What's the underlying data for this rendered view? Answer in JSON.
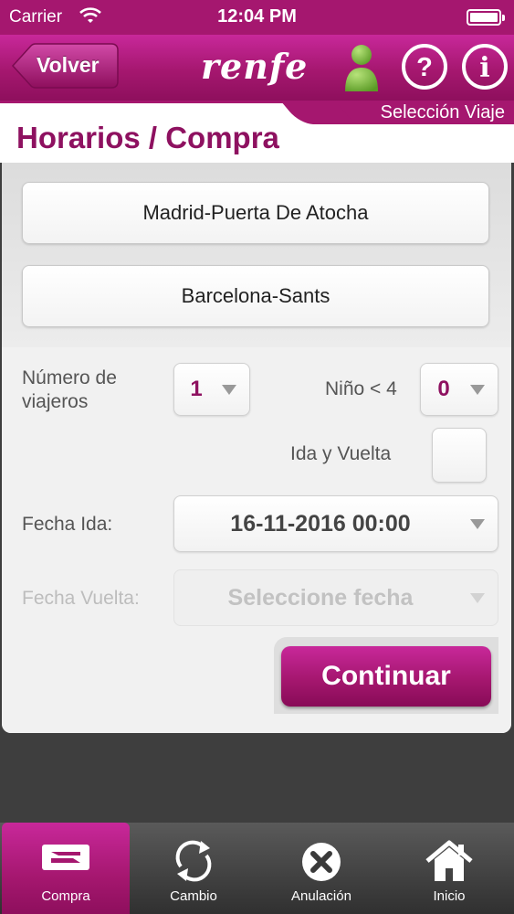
{
  "status_bar": {
    "carrier": "Carrier",
    "time": "12:04 PM"
  },
  "nav": {
    "back_label": "Volver",
    "brand": "renfe"
  },
  "step_label": "Selección Viaje",
  "page_title": "Horarios / Compra",
  "origin_station": "Madrid-Puerta De Atocha",
  "destination_station": "Barcelona-Sants",
  "travelers": {
    "label": "Número de viajeros",
    "value": "1"
  },
  "children": {
    "label": "Niño < 4",
    "value": "0"
  },
  "round_trip": {
    "label": "Ida y Vuelta",
    "checked": false
  },
  "departure_date": {
    "label": "Fecha Ida:",
    "value": "16-11-2016 00:00"
  },
  "return_date": {
    "label": "Fecha Vuelta:",
    "placeholder": "Seleccione fecha"
  },
  "continue_label": "Continuar",
  "tabs": [
    {
      "label": "Compra",
      "icon": "ticket-icon",
      "active": true
    },
    {
      "label": "Cambio",
      "icon": "exchange-icon",
      "active": false
    },
    {
      "label": "Anulación",
      "icon": "cancel-icon",
      "active": false
    },
    {
      "label": "Inicio",
      "icon": "home-icon",
      "active": false
    }
  ],
  "colors": {
    "brand": "#a5176f",
    "brand_dark": "#8e1160",
    "user_icon": "#7dc142"
  }
}
